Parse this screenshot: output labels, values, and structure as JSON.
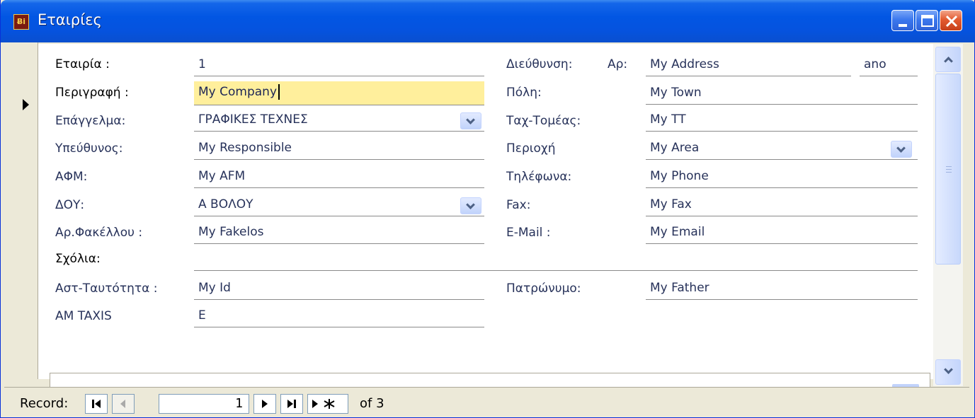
{
  "window": {
    "title": "Εταιρίες",
    "icon": "access-form-icon"
  },
  "fields_left": [
    {
      "label": "Εταιρία :",
      "value": "1",
      "dark": true
    },
    {
      "label": "Περιγραφή :",
      "value": "My Company",
      "dark": true,
      "active": true
    },
    {
      "label": "Επάγγελμα:",
      "value": "ΓΡΑΦΙΚΕΣ ΤΕΧΝΕΣ",
      "dropdown": true
    },
    {
      "label": "Υπεύθυνος:",
      "value": "My Responsible"
    },
    {
      "label": "ΑΦΜ:",
      "value": "My AFM"
    },
    {
      "label": "ΔΟΥ:",
      "value": "Α ΒΟΛΟΥ",
      "dropdown": true
    },
    {
      "label": "Αρ.Φακέλλου :",
      "value": "My Fakelos"
    },
    {
      "label": "Σχόλια:",
      "value": "",
      "dark": true
    },
    {
      "label": "Αστ-Ταυτότητα :",
      "value": "My Id"
    },
    {
      "label": "AM TAXIS",
      "value": "E"
    }
  ],
  "fields_right": [
    {
      "label": "Διεύθυνση:",
      "sublabel": "Αρ:",
      "value": "My Address",
      "extra": "ano"
    },
    {
      "label": "Πόλη:",
      "value": "My Town"
    },
    {
      "label": "Ταχ-Τομέας:",
      "value": "My TT"
    },
    {
      "label": "Περιοχή",
      "value": "My Area",
      "dropdown": true
    },
    {
      "label": "Τηλέφωνα:",
      "value": "My Phone"
    },
    {
      "label": "Fax:",
      "value": "My Fax"
    },
    {
      "label": "E-Mail :",
      "value": "My Email"
    },
    {
      "label": "Πατρώνυμο:",
      "value": "My Father"
    }
  ],
  "navigation": {
    "label": "Record:",
    "current": "1",
    "of_text": "of 3"
  }
}
